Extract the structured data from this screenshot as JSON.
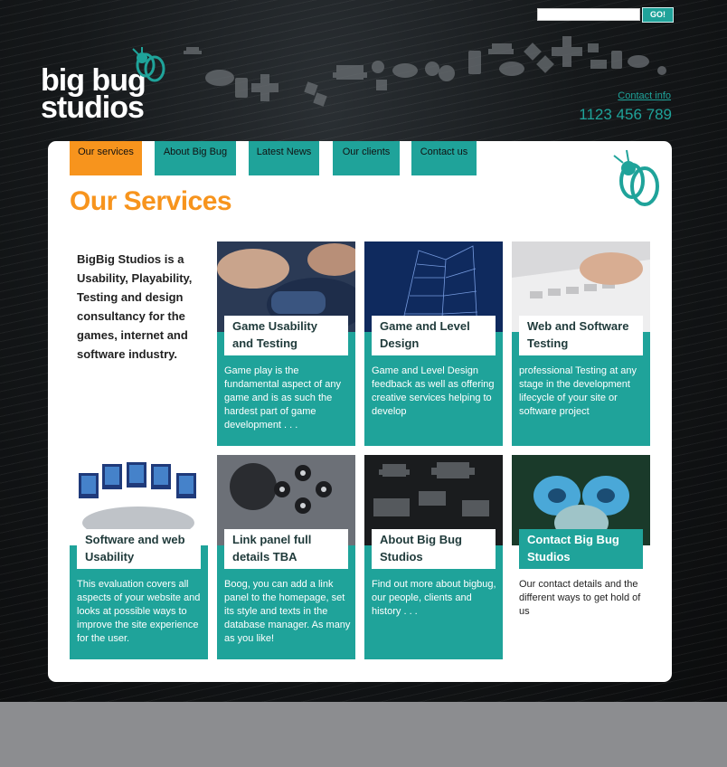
{
  "header": {
    "search": {
      "placeholder": ""
    },
    "go_label": "GO!",
    "logo_line1": "big bug",
    "logo_line2": "studios",
    "contact_link": "Contact info",
    "phone": "1123 456 789"
  },
  "nav": {
    "tabs": [
      {
        "label": "Our services"
      },
      {
        "label": "About Big Bug"
      },
      {
        "label": "Latest News"
      },
      {
        "label": "Our clients"
      },
      {
        "label": "Contact us"
      }
    ]
  },
  "main": {
    "title": "Our Services",
    "intro": "BigBig Studios is a Usability, Playability, Testing and design consultancy for the games, internet and software industry.",
    "cards": [
      {
        "title": "Game Usability and Testing",
        "desc": "Game play is the fundamental aspect of any game and is as such the hardest part of game development . . ."
      },
      {
        "title": "Game and Level Design",
        "desc": "Game and Level Design feedback as well as offering creative services helping to develop"
      },
      {
        "title": "Web and Software Testing",
        "desc": "professional Testing at any stage in the development lifecycle of your site or software project"
      },
      {
        "title": "Software and web Usability",
        "desc": "This evaluation covers all aspects of your website and looks at possible ways to improve the site experience for the user."
      },
      {
        "title": "Link panel full details TBA",
        "desc": "Boog, you can add a link panel to the homepage, set its style and texts in the database manager. As many as you like!"
      },
      {
        "title": "About Big Bug Studios",
        "desc": "Find out more about bigbug, our people, clients and history . . ."
      },
      {
        "title": "Contact Big Bug Studios",
        "desc": "Our contact details and the different ways to get hold of us"
      }
    ]
  },
  "colors": {
    "accent": "#1fa39a",
    "brand_orange": "#f7941d",
    "dark_bg": "#111315",
    "footer_grey": "#8c8d90"
  }
}
